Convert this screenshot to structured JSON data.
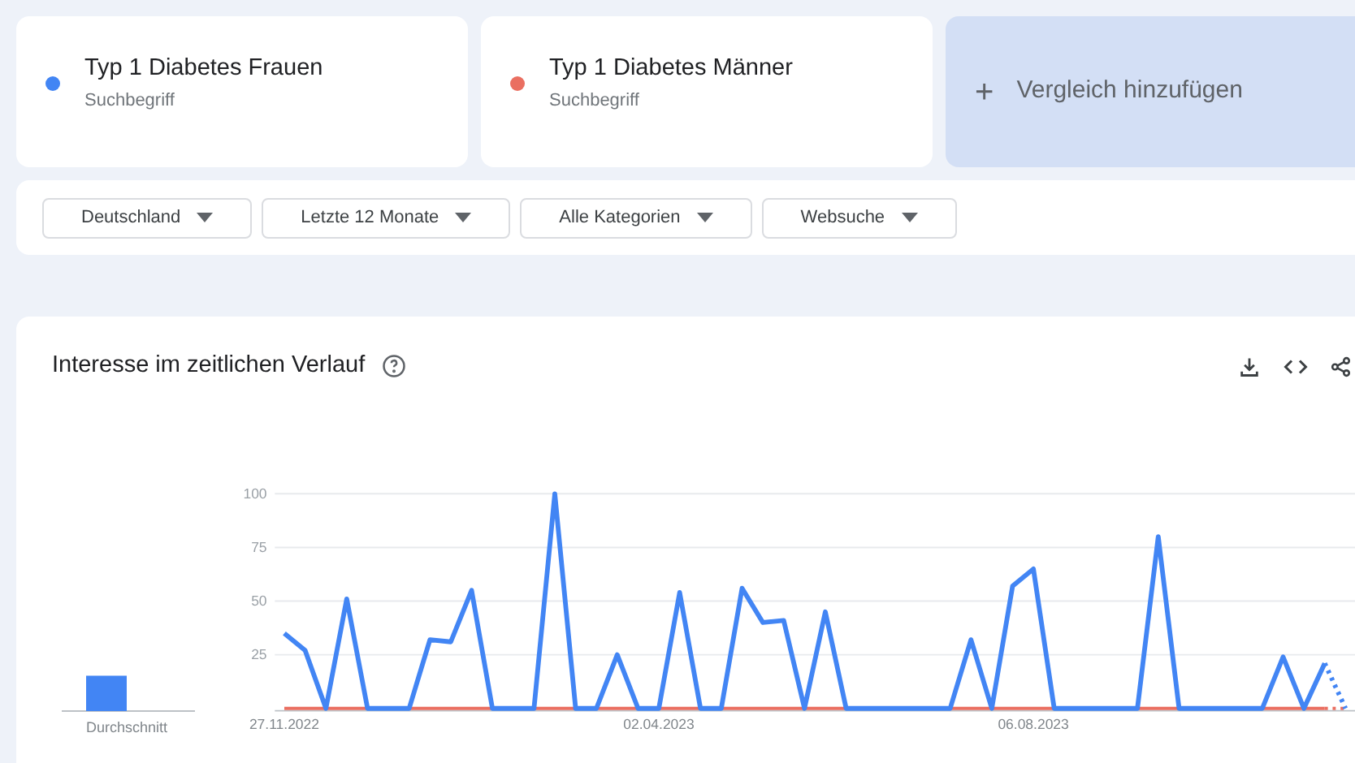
{
  "terms": [
    {
      "label": "Typ 1 Diabetes Frauen",
      "sublabel": "Suchbegriff",
      "color": "#4285f4"
    },
    {
      "label": "Typ 1 Diabetes Männer",
      "sublabel": "Suchbegriff",
      "color": "#ea6f61"
    }
  ],
  "add_compare": {
    "icon": "+",
    "label": "Vergleich hinzufügen"
  },
  "filters": [
    {
      "label": "Deutschland"
    },
    {
      "label": "Letzte 12 Monate"
    },
    {
      "label": "Alle Kategorien"
    },
    {
      "label": "Websuche"
    }
  ],
  "section": {
    "title": "Interesse im zeitlichen Verlauf",
    "average": {
      "chart_data": {
        "type": "bar",
        "categories": [
          "Durchschnitt"
        ],
        "ylim": [
          0,
          100
        ],
        "series": [
          {
            "color": "#4285f4",
            "values": [
              16
            ]
          }
        ]
      }
    },
    "chart_data": {
      "type": "line",
      "categories": [
        "27.11.2022",
        null,
        null,
        null,
        null,
        null,
        null,
        null,
        null,
        null,
        null,
        null,
        null,
        null,
        null,
        null,
        null,
        null,
        "02.04.2023",
        null,
        null,
        null,
        null,
        null,
        null,
        null,
        null,
        null,
        null,
        null,
        null,
        null,
        null,
        null,
        null,
        null,
        "06.08.2023",
        null,
        null,
        null,
        null,
        null,
        null,
        null,
        null,
        null,
        null,
        null,
        null,
        null,
        null,
        null
      ],
      "yticks": [
        25,
        50,
        75,
        100
      ],
      "ylim": [
        0,
        100
      ],
      "grid": true,
      "series": [
        {
          "color": "#4285f4",
          "values": [
            35,
            27,
            0,
            51,
            0,
            0,
            0,
            32,
            31,
            55,
            0,
            0,
            0,
            100,
            0,
            0,
            25,
            0,
            0,
            54,
            0,
            0,
            56,
            40,
            41,
            0,
            45,
            0,
            0,
            0,
            0,
            0,
            0,
            32,
            0,
            57,
            65,
            0,
            0,
            0,
            0,
            0,
            80,
            0,
            0,
            0,
            0,
            0,
            24,
            0,
            21,
            0
          ]
        },
        {
          "color": "#ea6f61",
          "values": [
            0,
            0,
            0,
            0,
            0,
            0,
            0,
            0,
            0,
            0,
            0,
            0,
            0,
            0,
            0,
            0,
            0,
            0,
            0,
            0,
            0,
            0,
            0,
            0,
            0,
            0,
            0,
            0,
            0,
            0,
            0,
            0,
            0,
            0,
            0,
            0,
            0,
            0,
            0,
            0,
            0,
            0,
            0,
            0,
            0,
            0,
            0,
            0,
            0,
            0,
            0,
            0
          ]
        }
      ]
    }
  }
}
